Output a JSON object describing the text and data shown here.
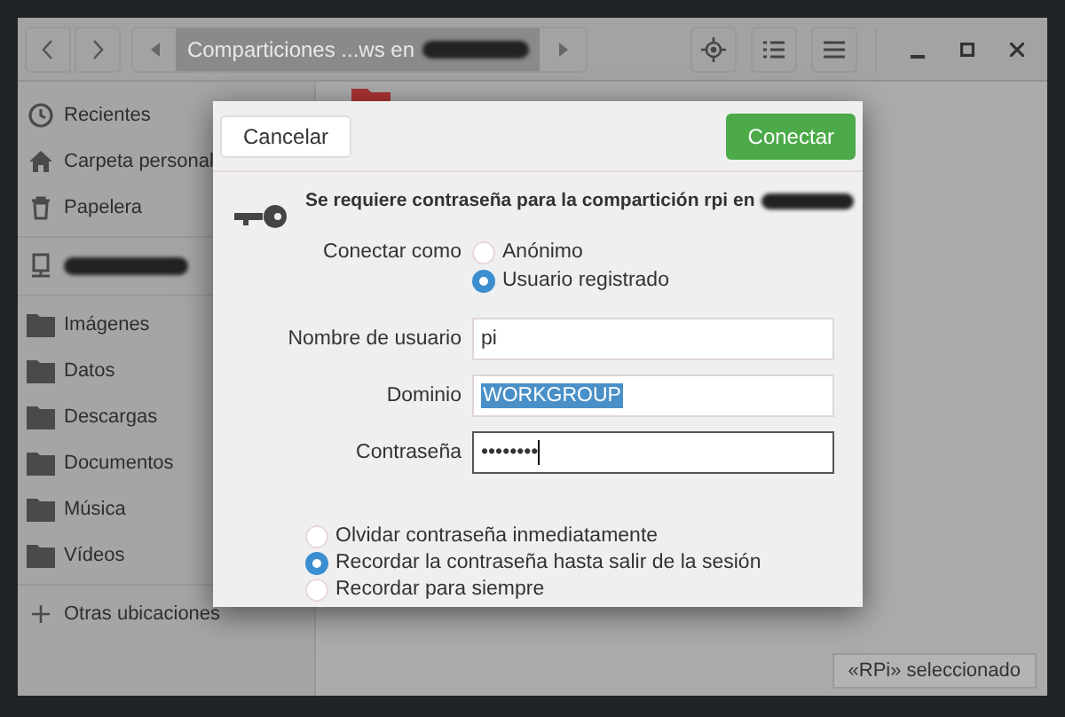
{
  "header": {
    "path": "Comparticiones ...ws en"
  },
  "sidebar": {
    "items": [
      {
        "label": "Recientes",
        "kind": "recent"
      },
      {
        "label": "Carpeta personal",
        "kind": "home"
      },
      {
        "label": "Papelera",
        "kind": "trash"
      },
      {
        "kind": "network"
      },
      {
        "label": "Imágenes",
        "kind": "folder"
      },
      {
        "label": "Datos",
        "kind": "folder"
      },
      {
        "label": "Descargas",
        "kind": "folder"
      },
      {
        "label": "Documentos",
        "kind": "folder"
      },
      {
        "label": "Música",
        "kind": "folder"
      },
      {
        "label": "Vídeos",
        "kind": "folder"
      },
      {
        "label": "Otras ubicaciones",
        "kind": "other"
      }
    ]
  },
  "dialog": {
    "cancel": "Cancelar",
    "connect": "Conectar",
    "message": "Se requiere contraseña para la compartición rpi en",
    "connect_as": {
      "label": "Conectar como",
      "options": [
        {
          "label": "Anónimo",
          "selected": false
        },
        {
          "label": "Usuario registrado",
          "selected": true
        }
      ]
    },
    "fields": [
      {
        "label": "Nombre de usuario",
        "value": "pi",
        "highlighted": false,
        "focused": false
      },
      {
        "label": "Dominio",
        "value": "WORKGROUP",
        "highlighted": true,
        "focused": false
      },
      {
        "label": "Contraseña",
        "value": "••••••••",
        "highlighted": false,
        "focused": true
      }
    ],
    "remember": [
      {
        "label": "Olvidar contraseña inmediatamente",
        "selected": false
      },
      {
        "label": "Recordar la contraseña hasta salir de la sesión",
        "selected": true
      },
      {
        "label": "Recordar para siempre",
        "selected": false
      }
    ]
  },
  "status": "«RPi» seleccionado"
}
